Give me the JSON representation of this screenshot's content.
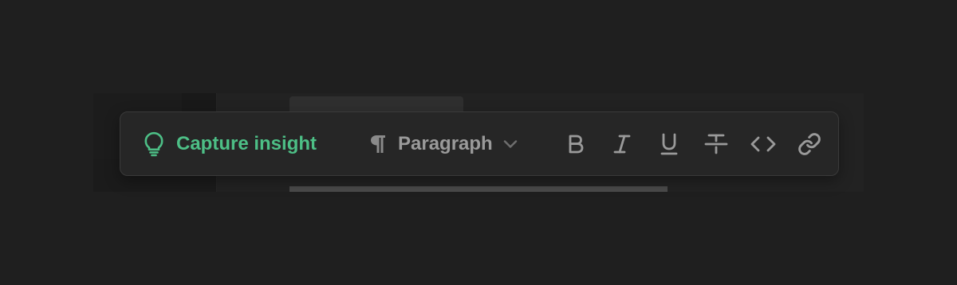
{
  "toolbar": {
    "insight": {
      "label": "Capture insight",
      "icon": "lightbulb-icon",
      "color": "#4dbf86"
    },
    "block_type": {
      "label": "Paragraph",
      "icon": "pilcrow-icon",
      "dropdown_icon": "chevron-down-icon"
    },
    "format_buttons": [
      {
        "icon": "bold-icon"
      },
      {
        "icon": "italic-icon"
      },
      {
        "icon": "underline-icon"
      },
      {
        "icon": "strikethrough-icon"
      },
      {
        "icon": "code-icon"
      },
      {
        "icon": "link-icon"
      }
    ]
  }
}
